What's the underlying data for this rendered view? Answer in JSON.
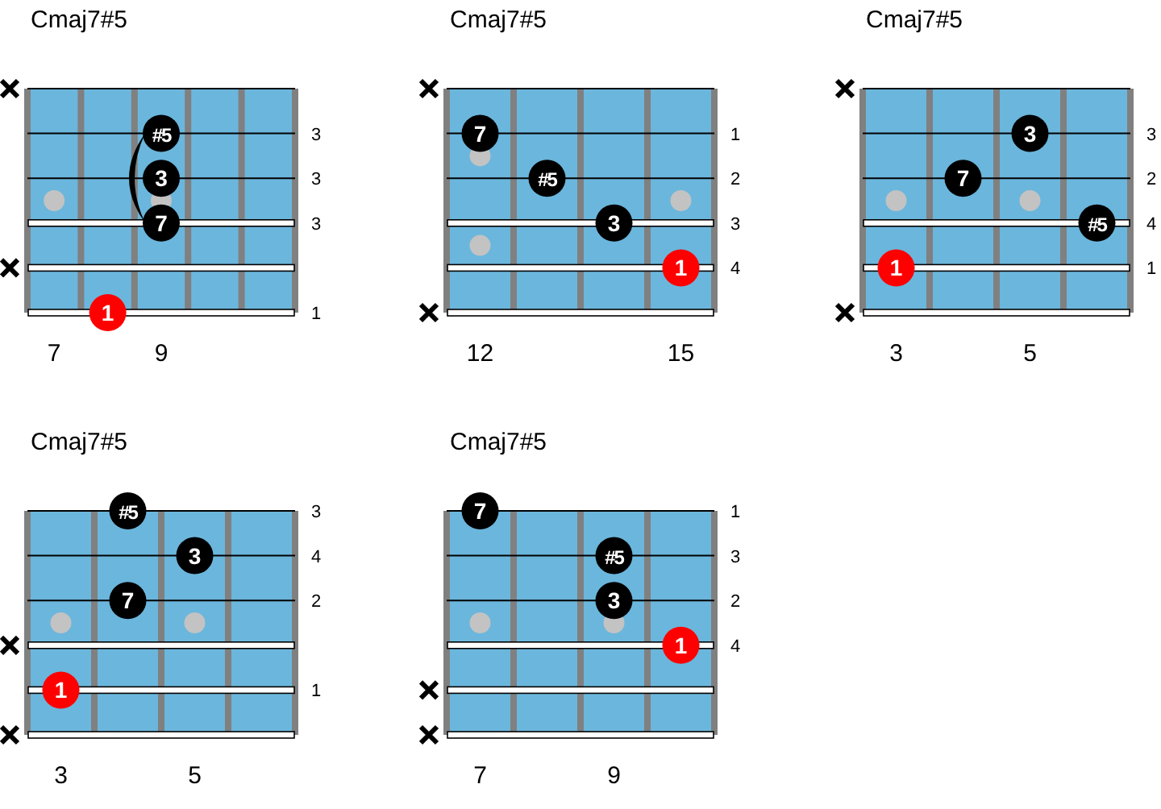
{
  "diagrams": [
    {
      "title": "Cmaj7#5",
      "frets": [
        {
          "label": "7",
          "inlay": true
        },
        {
          "inlay": false
        },
        {
          "label": "9",
          "inlay": true
        },
        {
          "inlay": false
        },
        {
          "inlay": false
        }
      ],
      "strings": [
        {
          "muted": true,
          "cells": [
            null,
            null,
            null,
            null,
            null
          ]
        },
        {
          "muted": false,
          "finger": "3",
          "cells": [
            null,
            null,
            {
              "label": "#5",
              "kind": "tone",
              "barre": true
            },
            null,
            null
          ]
        },
        {
          "muted": false,
          "finger": "3",
          "cells": [
            null,
            null,
            {
              "label": "3",
              "kind": "tone",
              "barre": true
            },
            null,
            null
          ]
        },
        {
          "muted": false,
          "finger": "3",
          "cells": [
            null,
            null,
            {
              "label": "7",
              "kind": "tone",
              "barre": true
            },
            null,
            null
          ]
        },
        {
          "muted": true,
          "cells": [
            null,
            null,
            null,
            null,
            null
          ]
        },
        {
          "muted": false,
          "finger": "1",
          "cells": [
            null,
            {
              "label": "1",
              "kind": "root"
            },
            null,
            null,
            null
          ]
        }
      ]
    },
    {
      "title": "Cmaj7#5",
      "frets": [
        {
          "label": "12",
          "inlay": true,
          "double": true
        },
        {
          "inlay": false
        },
        {
          "inlay": false
        },
        {
          "label": "15",
          "inlay": true
        }
      ],
      "strings": [
        {
          "muted": true,
          "cells": [
            null,
            null,
            null,
            null
          ]
        },
        {
          "muted": false,
          "finger": "1",
          "cells": [
            {
              "label": "7",
              "kind": "tone"
            },
            null,
            null,
            null
          ]
        },
        {
          "muted": false,
          "finger": "2",
          "cells": [
            null,
            {
              "label": "#5",
              "kind": "tone"
            },
            null,
            null
          ]
        },
        {
          "muted": false,
          "finger": "3",
          "cells": [
            null,
            null,
            {
              "label": "3",
              "kind": "tone"
            },
            null
          ]
        },
        {
          "muted": false,
          "finger": "4",
          "cells": [
            null,
            null,
            null,
            {
              "label": "1",
              "kind": "root"
            }
          ]
        },
        {
          "muted": true,
          "cells": [
            null,
            null,
            null,
            null
          ]
        }
      ]
    },
    {
      "title": "Cmaj7#5",
      "frets": [
        {
          "label": "3",
          "inlay": true
        },
        {
          "inlay": false
        },
        {
          "label": "5",
          "inlay": true
        },
        {
          "inlay": false
        }
      ],
      "strings": [
        {
          "muted": true,
          "cells": [
            null,
            null,
            null,
            null
          ]
        },
        {
          "muted": false,
          "finger": "3",
          "cells": [
            null,
            null,
            {
              "label": "3",
              "kind": "tone"
            },
            null
          ]
        },
        {
          "muted": false,
          "finger": "2",
          "cells": [
            null,
            {
              "label": "7",
              "kind": "tone"
            },
            null,
            null
          ]
        },
        {
          "muted": false,
          "finger": "4",
          "cells": [
            null,
            null,
            null,
            {
              "label": "#5",
              "kind": "tone"
            }
          ]
        },
        {
          "muted": false,
          "finger": "1",
          "cells": [
            {
              "label": "1",
              "kind": "root"
            },
            null,
            null,
            null
          ]
        },
        {
          "muted": true,
          "cells": [
            null,
            null,
            null,
            null
          ]
        }
      ]
    },
    {
      "title": "Cmaj7#5",
      "frets": [
        {
          "label": "3",
          "inlay": true
        },
        {
          "inlay": false
        },
        {
          "label": "5",
          "inlay": true
        },
        {
          "inlay": false
        }
      ],
      "strings": [
        {
          "muted": false,
          "finger": "3",
          "cells": [
            null,
            {
              "label": "#5",
              "kind": "tone"
            },
            null,
            null
          ]
        },
        {
          "muted": false,
          "finger": "4",
          "cells": [
            null,
            null,
            {
              "label": "3",
              "kind": "tone"
            },
            null
          ]
        },
        {
          "muted": false,
          "finger": "2",
          "cells": [
            null,
            {
              "label": "7",
              "kind": "tone"
            },
            null,
            null
          ]
        },
        {
          "muted": true,
          "cells": [
            null,
            null,
            null,
            null
          ]
        },
        {
          "muted": false,
          "finger": "1",
          "cells": [
            {
              "label": "1",
              "kind": "root"
            },
            null,
            null,
            null
          ]
        },
        {
          "muted": true,
          "cells": [
            null,
            null,
            null,
            null
          ]
        }
      ]
    },
    {
      "title": "Cmaj7#5",
      "frets": [
        {
          "label": "7",
          "inlay": true
        },
        {
          "inlay": false
        },
        {
          "label": "9",
          "inlay": true
        },
        {
          "inlay": false
        }
      ],
      "strings": [
        {
          "muted": false,
          "finger": "1",
          "cells": [
            {
              "label": "7",
              "kind": "tone"
            },
            null,
            null,
            null
          ]
        },
        {
          "muted": false,
          "finger": "3",
          "cells": [
            null,
            null,
            {
              "label": "#5",
              "kind": "tone"
            },
            null
          ]
        },
        {
          "muted": false,
          "finger": "2",
          "cells": [
            null,
            null,
            {
              "label": "3",
              "kind": "tone"
            },
            null
          ]
        },
        {
          "muted": false,
          "finger": "4",
          "cells": [
            null,
            null,
            null,
            {
              "label": "1",
              "kind": "root"
            }
          ]
        },
        {
          "muted": true,
          "cells": [
            null,
            null,
            null,
            null
          ]
        },
        {
          "muted": true,
          "cells": [
            null,
            null,
            null,
            null
          ]
        }
      ]
    }
  ]
}
